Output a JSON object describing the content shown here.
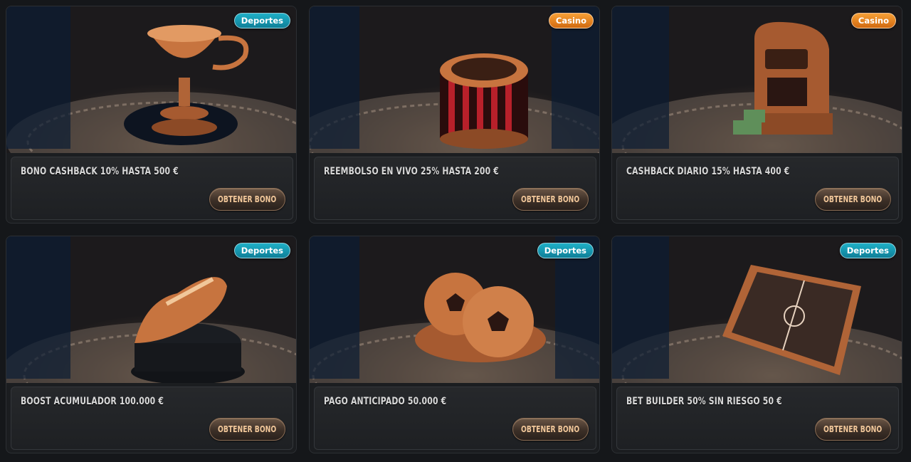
{
  "cards": [
    {
      "badge": "Deportes",
      "badge_type": "sport",
      "title": "BONO CASHBACK 10% HASTA 500 €",
      "button": "OBTENER BONO",
      "art_icon": "trophy-icon"
    },
    {
      "badge": "Casino",
      "badge_type": "casino",
      "title": "REEMBOLSO EN VIVO 25% HASTA 200 €",
      "button": "OBTENER BONO",
      "art_icon": "roulette-icon"
    },
    {
      "badge": "Casino",
      "badge_type": "casino",
      "title": "CASHBACK DIARIO 15% HASTA 400 €",
      "button": "OBTENER BONO",
      "art_icon": "slot-machine-icon"
    },
    {
      "badge": "Deportes",
      "badge_type": "sport",
      "title": "BOOST ACUMULADOR 100.000 €",
      "button": "OBTENER BONO",
      "art_icon": "football-boot-icon"
    },
    {
      "badge": "Deportes",
      "badge_type": "sport",
      "title": "PAGO ANTICIPADO 50.000 €",
      "button": "OBTENER BONO",
      "art_icon": "soccer-balls-icon"
    },
    {
      "badge": "Deportes",
      "badge_type": "sport",
      "title": "BET BUILDER 50% SIN RIESGO 50 €",
      "button": "OBTENER BONO",
      "art_icon": "tactics-board-icon"
    }
  ],
  "colors": {
    "sport_badge": "#1fb0c7",
    "casino_badge": "#f6a037",
    "button_text": "#f1c79a",
    "copper": "#c7743f"
  }
}
